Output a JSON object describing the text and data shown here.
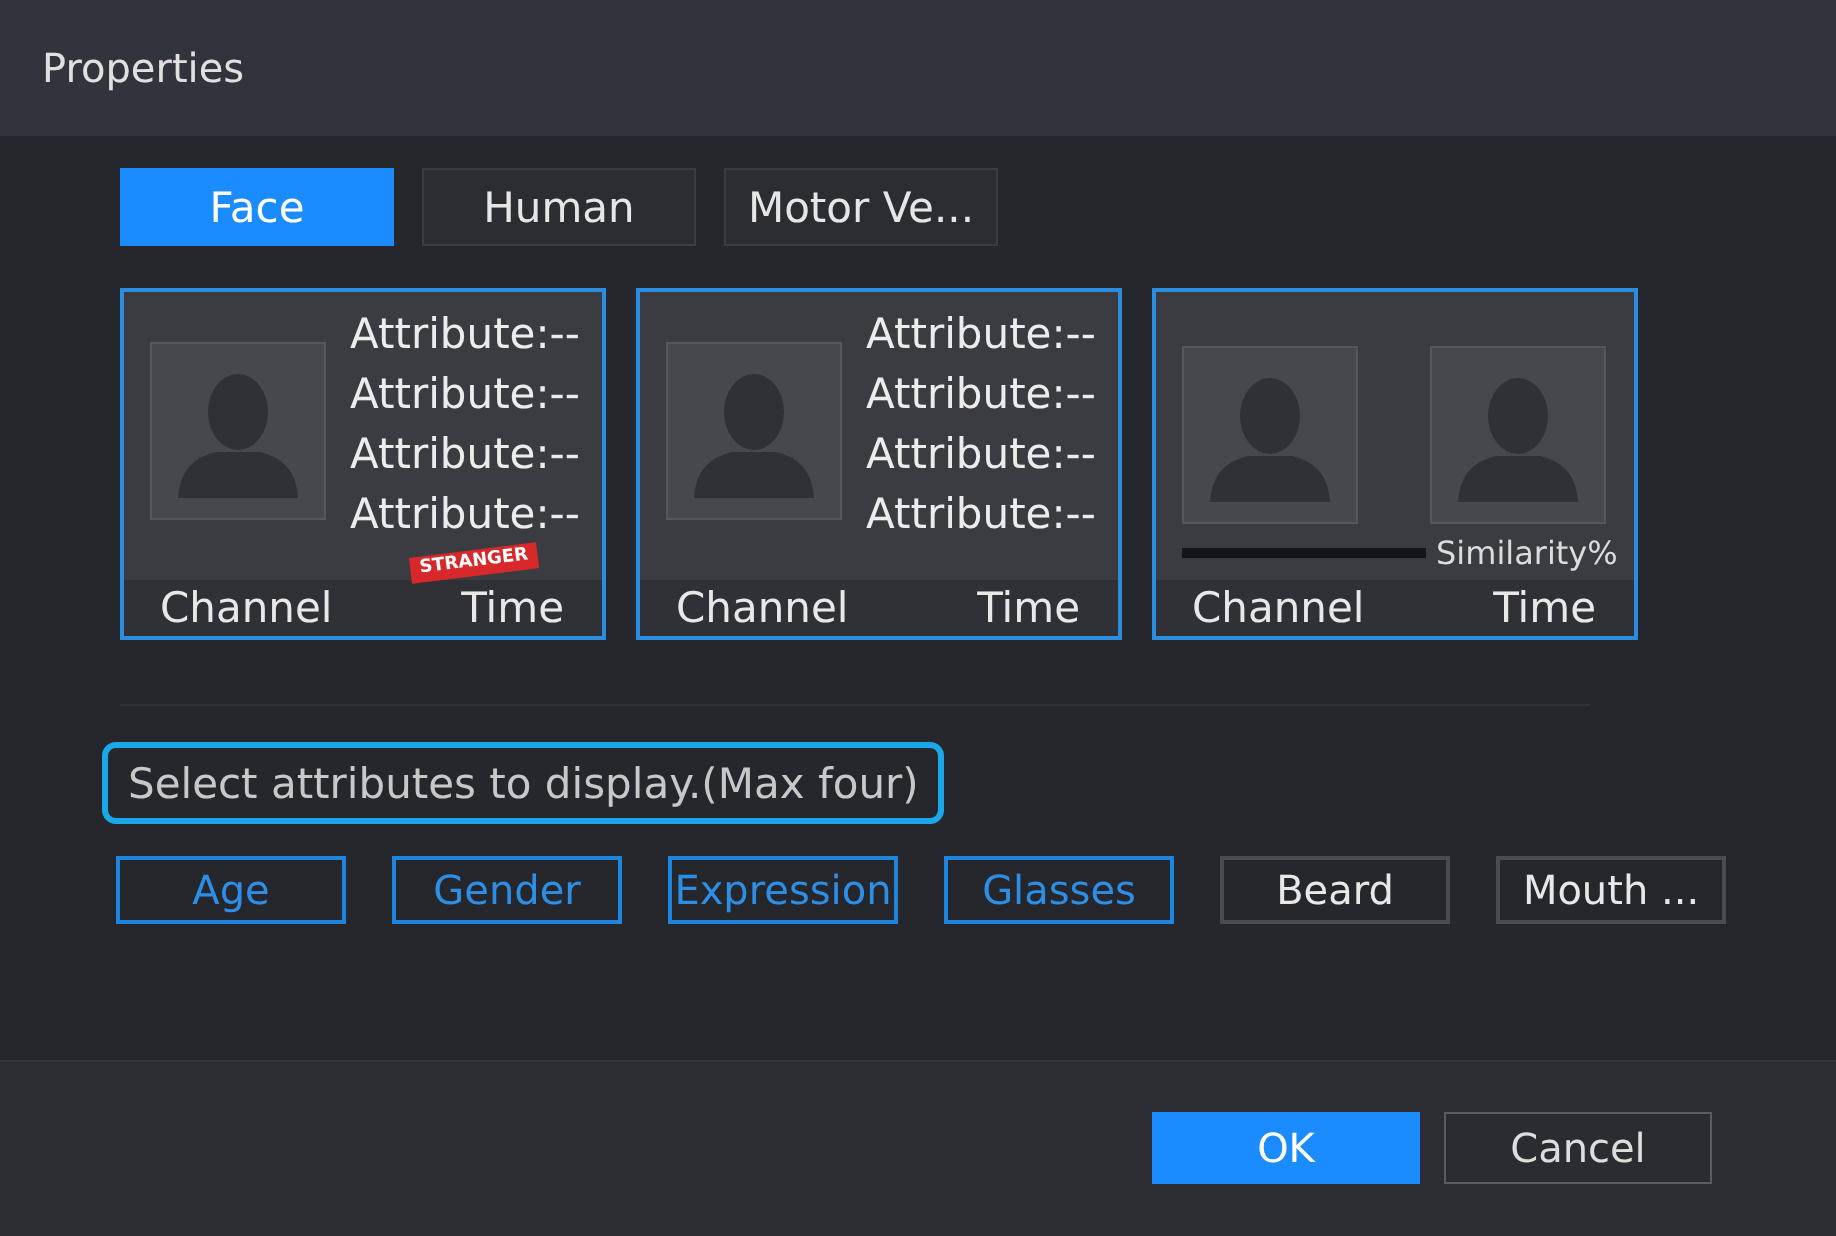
{
  "window": {
    "title": "Properties"
  },
  "tabs": [
    {
      "label": "Face",
      "selected": true
    },
    {
      "label": "Human",
      "selected": false
    },
    {
      "label": "Motor Ve...",
      "selected": false
    }
  ],
  "previews": [
    {
      "kind": "attributes",
      "attributes": [
        "Attribute:--",
        "Attribute:--",
        "Attribute:--",
        "Attribute:--"
      ],
      "badge": "STRANGER",
      "channel": "Channel",
      "time": "Time"
    },
    {
      "kind": "attributes",
      "attributes": [
        "Attribute:--",
        "Attribute:--",
        "Attribute:--",
        "Attribute:--"
      ],
      "channel": "Channel",
      "time": "Time"
    },
    {
      "kind": "comparison",
      "similarity": "Similarity%",
      "channel": "Channel",
      "time": "Time"
    }
  ],
  "hint": {
    "text": "Select attributes to display.(Max four)",
    "highlighted": true
  },
  "attribute_options": [
    {
      "label": "Age",
      "selected": true
    },
    {
      "label": "Gender",
      "selected": true
    },
    {
      "label": "Expression",
      "selected": true
    },
    {
      "label": "Glasses",
      "selected": true
    },
    {
      "label": "Beard",
      "selected": false
    },
    {
      "label": "Mouth ...",
      "selected": false
    }
  ],
  "buttons": [
    {
      "label": "OK",
      "kind": "primary"
    },
    {
      "label": "Cancel",
      "kind": "secondary"
    }
  ]
}
